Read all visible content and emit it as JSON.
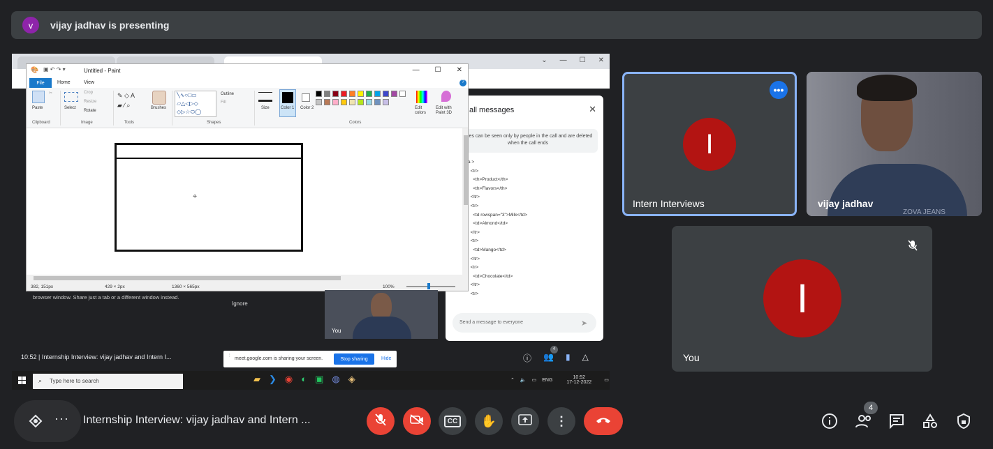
{
  "banner": {
    "avatar_letter": "v",
    "text": "vijay jadhav is presenting"
  },
  "shared_screen": {
    "paint": {
      "title": "Untitled - Paint",
      "menu": {
        "file": "File",
        "home": "Home",
        "view": "View"
      },
      "groups": {
        "clipboard": "Clipboard",
        "image": "Image",
        "tools": "Tools",
        "shapes": "Shapes",
        "colors": "Colors"
      },
      "buttons": {
        "paste": "Paste",
        "select": "Select",
        "crop": "Crop",
        "resize": "Resize",
        "rotate": "Rotate",
        "brushes": "Brushes",
        "outline": "Outline",
        "fill": "Fill",
        "size": "Size",
        "color1": "Color 1",
        "color2": "Color 2",
        "edit_colors": "Edit colors",
        "edit_paint3d": "Edit with Paint 3D"
      },
      "palette": [
        "#000000",
        "#7f7f7f",
        "#880015",
        "#ed1c24",
        "#ff7f27",
        "#fff200",
        "#22b14c",
        "#00a2e8",
        "#3f48cc",
        "#a349a4",
        "#ffffff",
        "#c3c3c3",
        "#b97a57",
        "#ffaec9",
        "#ffc90e",
        "#efe4b0",
        "#b5e61d",
        "#99d9ea",
        "#7092be",
        "#c8bfe7"
      ],
      "status": {
        "cursor": "382, 151px",
        "selection": "429 × 2px",
        "canvas_size": "1360 × 565px",
        "zoom": "100%"
      }
    },
    "chat": {
      "header": "all messages",
      "note": "ages can be seen only by people in the call and are deleted when the call ends",
      "code": "a >\n  <tr>\n    <th>Product</th>\n    <th>Flavors</th>\n  </tr>\n  <tr>\n    <td rowspan=\"3\">Milk</td>\n    <td>Almond</td>\n  </tr>\n  <tr>\n    <td>Mango</td>\n  </tr>\n  <tr>\n    <td>Chocolate</td>\n  </tr>\n  <tr>",
      "input_placeholder": "Send a message to everyone"
    },
    "share_warning": "browser window. Share just a tab or a different window instead.",
    "ignore": "Ignore",
    "self_label": "You",
    "stopbar": {
      "text": "meet.google.com is sharing your screen.",
      "stop": "Stop sharing",
      "hide": "Hide"
    },
    "meeting_line": "10:52  |  Internship Interview: vijay jadhav and Intern I...",
    "inner_people_count": "4",
    "taskbar": {
      "search": "Type here to search",
      "lang": "ENG",
      "time": "10:52",
      "date": "17-12-2022"
    }
  },
  "tiles": {
    "intern": {
      "letter": "I",
      "name": "Intern Interviews"
    },
    "vijay": {
      "name": "vijay jadhav",
      "shirt_text": "ZOVA JEANS"
    },
    "you": {
      "letter": "I",
      "name": "You"
    }
  },
  "bottom": {
    "meeting_title": "Internship Interview: vijay jadhav and Intern ...",
    "people_count": "4"
  }
}
